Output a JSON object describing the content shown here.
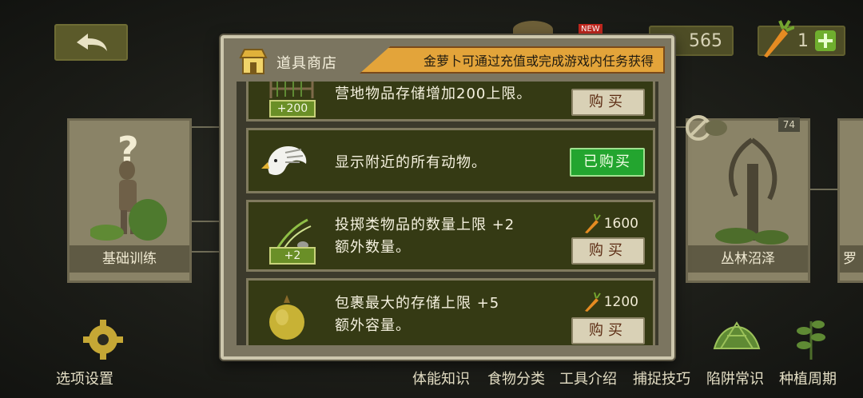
{
  "background": {
    "coins": "565",
    "carrots": "1",
    "new_badge": "NEW",
    "left_card": {
      "label": "基础训练",
      "mark": "?"
    },
    "right_card": {
      "label": "丛林沼泽",
      "number": "74"
    },
    "far_card_label": "罗",
    "settings_label": "选项设置",
    "bottom_nav": [
      "体能知识",
      "食物分类",
      "工具介绍",
      "捕捉技巧",
      "陷阱常识",
      "种植周期"
    ]
  },
  "shop": {
    "title": "道具商店",
    "banner": "金萝卜可通过充值或完成游戏内任务获得",
    "items": [
      {
        "icon": "storage-rack-icon",
        "badge": "+200",
        "desc": "营地物品存储增加200上限。",
        "status": "buy",
        "buy_label": "购买"
      },
      {
        "icon": "eagle-icon",
        "desc": "显示附近的所有动物。",
        "status": "bought",
        "bought_label": "已购买"
      },
      {
        "icon": "bow-arrows-icon",
        "badge": "+2",
        "desc_line1": "投掷类物品的数量上限 +2",
        "desc_line2": "额外数量。",
        "price": "1600",
        "status": "buy",
        "buy_label": "购买"
      },
      {
        "icon": "pouch-icon",
        "desc_line1": "包裹最大的存储上限 +5",
        "desc_line2": "额外容量。",
        "price": "1200",
        "status": "buy",
        "buy_label": "购买"
      }
    ]
  },
  "colors": {
    "modal_frame": "#cdc7ad",
    "item_bg": "#353a14",
    "bought_green": "#23a52f",
    "banner_orange": "#e3a43a"
  }
}
